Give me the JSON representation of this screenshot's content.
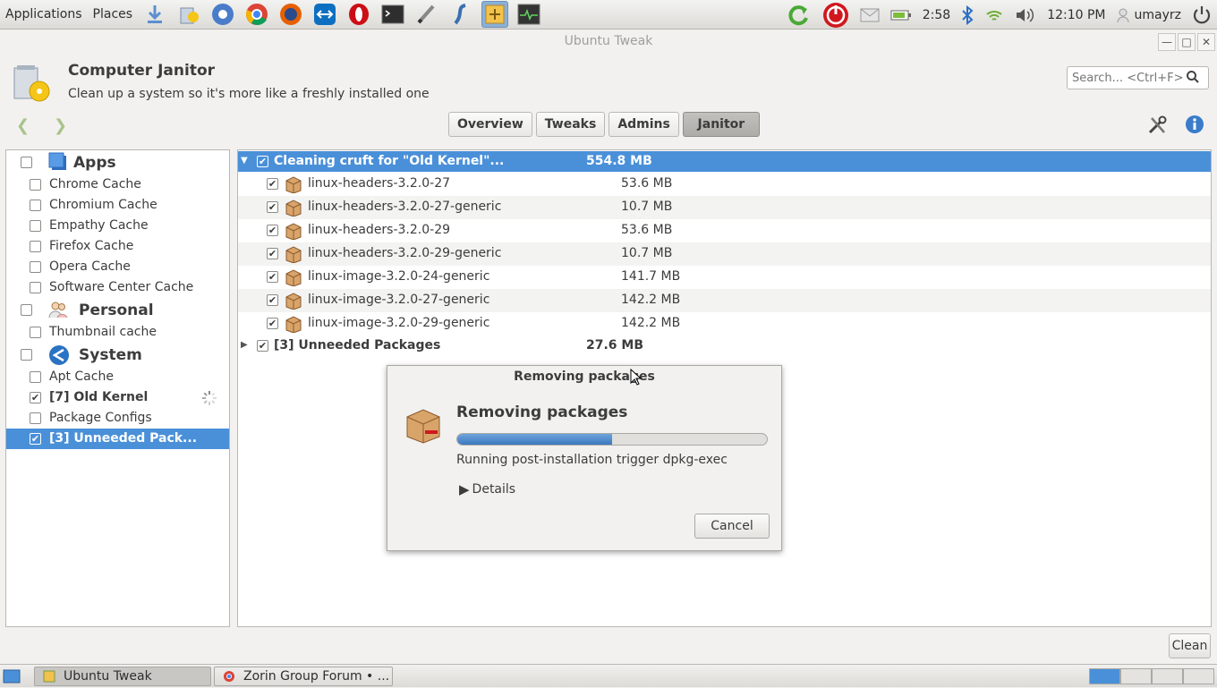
{
  "top_panel": {
    "menus": [
      "Applications",
      "Places"
    ],
    "launchers": [
      "download-icon",
      "file-manager-icon",
      "chromium-icon",
      "chrome-icon",
      "firefox-icon",
      "teamviewer-icon",
      "opera-icon",
      "terminal-icon",
      "text-editor-icon",
      "app-launcher-icon",
      "ubuntu-tweak-icon",
      "system-monitor-icon"
    ],
    "battery_time": "2:58",
    "clock": "12:10 PM",
    "user": "umayrz"
  },
  "window": {
    "title": "Ubuntu Tweak",
    "feature_title": "Computer Janitor",
    "feature_desc": "Clean up a system so it's more like a freshly installed one",
    "search_placeholder": "Search... <Ctrl+F>",
    "tabs": [
      {
        "label": "Overview",
        "active": false
      },
      {
        "label": "Tweaks",
        "active": false
      },
      {
        "label": "Admins",
        "active": false
      },
      {
        "label": "Janitor",
        "active": true
      }
    ],
    "clean_label": "Clean"
  },
  "sidebar": {
    "categories": [
      {
        "label": "Apps",
        "items": [
          "Chrome Cache",
          "Chromium Cache",
          "Empathy Cache",
          "Firefox Cache",
          "Opera Cache",
          "Software Center Cache"
        ]
      },
      {
        "label": "Personal",
        "items": [
          "Thumbnail cache"
        ]
      },
      {
        "label": "System",
        "items": [
          "Apt Cache",
          "[7] Old Kernel",
          "Package Configs",
          "[3] Unneeded Pack..."
        ]
      }
    ]
  },
  "content": {
    "group1": {
      "label": "Cleaning cruft for \"Old Kernel\"...",
      "size": "554.8 MB"
    },
    "packages": [
      {
        "name": "linux-headers-3.2.0-27",
        "size": "53.6 MB"
      },
      {
        "name": "linux-headers-3.2.0-27-generic",
        "size": "10.7 MB"
      },
      {
        "name": "linux-headers-3.2.0-29",
        "size": "53.6 MB"
      },
      {
        "name": "linux-headers-3.2.0-29-generic",
        "size": "10.7 MB"
      },
      {
        "name": "linux-image-3.2.0-24-generic",
        "size": "141.7 MB"
      },
      {
        "name": "linux-image-3.2.0-27-generic",
        "size": "142.2 MB"
      },
      {
        "name": "linux-image-3.2.0-29-generic",
        "size": "142.2 MB"
      }
    ],
    "group2": {
      "label": "[3] Unneeded Packages",
      "size": "27.6 MB"
    }
  },
  "dialog": {
    "title": "Removing packages",
    "heading": "Removing packages",
    "progress": 0.5,
    "status": "Running post-installation trigger dpkg-exec",
    "details_label": "Details",
    "cancel_label": "Cancel"
  },
  "bottom_panel": {
    "tasks": [
      "Ubuntu Tweak",
      "Zorin Group Forum • ..."
    ]
  },
  "colors": {
    "selection": "#4a90d9",
    "progress": "#3a78bf"
  }
}
